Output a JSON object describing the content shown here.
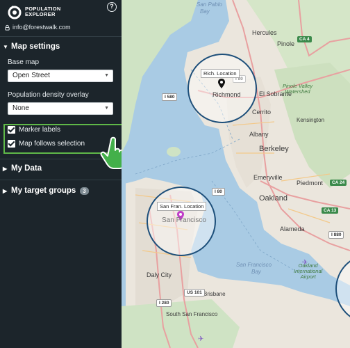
{
  "app": {
    "brand_line1": "POPULATION",
    "brand_line2": "EXPLORER",
    "help_icon": "?",
    "account_email": "info@forestwalk.com"
  },
  "map_settings": {
    "title": "Map settings",
    "base_map_label": "Base map",
    "base_map_value": "Open Street",
    "overlay_label": "Population density overlay",
    "overlay_value": "None",
    "marker_labels": "Marker labels",
    "map_follows": "Map follows selection"
  },
  "my_data": {
    "title": "My Data"
  },
  "target_groups": {
    "title": "My target groups",
    "count": "3"
  },
  "map": {
    "locations": [
      {
        "label": "Rich. Location",
        "city": "Richmond",
        "pin_color": "#000000"
      },
      {
        "label": "San Fran. Location",
        "city": "San Francisco",
        "pin_color": "#c03cc8"
      }
    ],
    "water_labels": [
      "San Pablo",
      "Bay",
      "San Francisco",
      "Bay"
    ],
    "city_labels": [
      "Hercules",
      "Pinole",
      "El Sobrante",
      "Cerrito",
      "Albany",
      "Berkeley",
      "Emeryville",
      "Piedmont",
      "Oakland",
      "Alameda",
      "Daly City",
      "South San Francisco",
      "Brisbane",
      "Kensington"
    ],
    "park_labels": [
      "Pinole Valley",
      "Watershed",
      "Oakland",
      "International",
      "Airport"
    ],
    "highways": [
      "CA 4",
      "I 80",
      "I 580",
      "I 80",
      "CA 24",
      "CA 13",
      "US 101",
      "I 280",
      "I 880"
    ]
  }
}
